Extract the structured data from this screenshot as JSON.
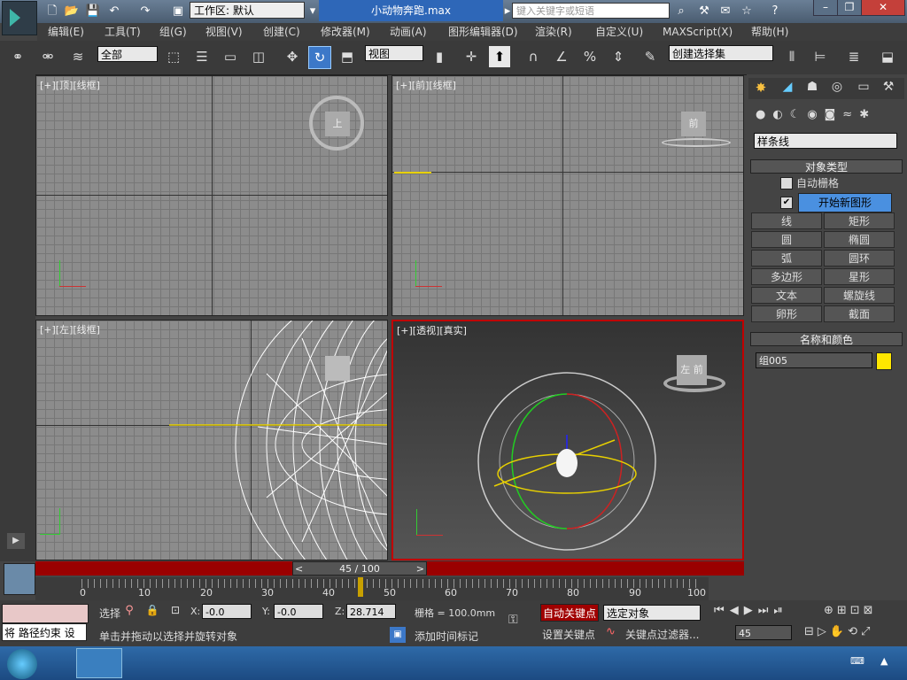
{
  "titlebar": {
    "workspace": "工作区: 默认",
    "doc_title": "小动物奔跑.max",
    "search_placeholder": "键入关键字或短语"
  },
  "menus": [
    "编辑(E)",
    "工具(T)",
    "组(G)",
    "视图(V)",
    "创建(C)",
    "修改器(M)",
    "动画(A)",
    "图形编辑器(D)",
    "渲染(R)",
    "自定义(U)",
    "MAXScript(X)",
    "帮助(H)"
  ],
  "toolbar": {
    "filter": "全部",
    "refcoord": "视图",
    "selset": "创建选择集"
  },
  "viewports": {
    "top": "[+][顶][线框]",
    "front": "[+][前][线框]",
    "left": "[+][左][线框]",
    "persp": "[+][透视][真实]",
    "cube_top": "上",
    "cube_front": "前",
    "cube_persp_a": "左",
    "cube_persp_b": "前"
  },
  "cmdpanel": {
    "category": "样条线",
    "object_type_title": "对象类型",
    "autogrid": "自动栅格",
    "start_new_shape": "开始新图形",
    "buttons": [
      "线",
      "矩形",
      "圆",
      "椭圆",
      "弧",
      "圆环",
      "多边形",
      "星形",
      "文本",
      "螺旋线",
      "卵形",
      "截面"
    ],
    "name_color_title": "名称和颜色",
    "object_name": "组005",
    "object_color": "#ffe600"
  },
  "timeline": {
    "frame": "45 / 100",
    "ticks": [
      "0",
      "10",
      "20",
      "30",
      "40",
      "50",
      "60",
      "70",
      "80",
      "90",
      "100"
    ]
  },
  "status": {
    "selected_label": "选择",
    "x_label": "X:",
    "x": "-0.0",
    "y_label": "Y:",
    "y": "-0.0",
    "z_label": "Z:",
    "z": "28.714",
    "grid": "栅格 = 100.0mm",
    "auto_key": "自动关键点",
    "key_mode": "选定对象",
    "set_key": "设置关键点",
    "key_filters": "关键点过滤器...",
    "current_frame": "45",
    "prompt_script": "将 路径约束 设",
    "prompt": "单击并拖动以选择并旋转对象",
    "add_time_tag": "添加时间标记"
  },
  "colors": {
    "accent": "#2e67b8",
    "timebar": "#9a0000",
    "autokey": "#a00000",
    "active_vp": "#c00000"
  }
}
